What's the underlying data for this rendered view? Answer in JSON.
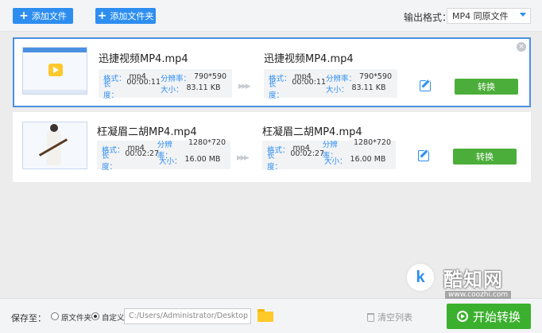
{
  "toolbar": {
    "add_file": "添加文件",
    "add_folder": "添加文件夹",
    "output_format_label": "输出格式：",
    "output_format_value": "MP4 同原文件"
  },
  "files": [
    {
      "name": "迅捷视频MP4.mp4",
      "src": {
        "format_k": "格式：",
        "format": "mp4",
        "res_k": "分辨率：",
        "res": "790*590",
        "dur_k": "长度：",
        "dur": "00:00:11",
        "size_k": "大小：",
        "size": "83.11 KB"
      },
      "out_name": "迅捷视频MP4.mp4",
      "dst": {
        "format_k": "格式：",
        "format": "mp4",
        "res_k": "分辨率：",
        "res": "790*590",
        "dur_k": "长度：",
        "dur": "00:00:11",
        "size_k": "大小：",
        "size": "83.11 KB"
      },
      "convert": "转换",
      "close": "×"
    },
    {
      "name": "枉凝眉二胡MP4.mp4",
      "src": {
        "format_k": "格式：",
        "format": "mp4",
        "res_k": "分辨率：",
        "res": "1280*720",
        "dur_k": "长度：",
        "dur": "00:02:27",
        "size_k": "大小：",
        "size": "16.00 MB"
      },
      "out_name": "枉凝眉二胡MP4.mp4",
      "dst": {
        "format_k": "格式：",
        "format": "mp4",
        "res_k": "分辨率：",
        "res": "1280*720",
        "dur_k": "长度：",
        "dur": "00:02:27",
        "size_k": "大小：",
        "size": "16.00 MB"
      },
      "convert": "转换"
    }
  ],
  "bottom": {
    "save_to": "保存至：",
    "opt_source": "原文件夹",
    "opt_custom": "自定义",
    "path": "C:/Users/Administrator/Desktop",
    "clear_list": "清空列表",
    "start": "开始转换"
  },
  "watermark": {
    "logo_k": "k",
    "text": "酷知网",
    "url": "www.coozhi.com"
  },
  "colors": {
    "accent": "#2d8ef0",
    "convert_green": "#4cae3a",
    "selected_border": "#4a90e2"
  }
}
